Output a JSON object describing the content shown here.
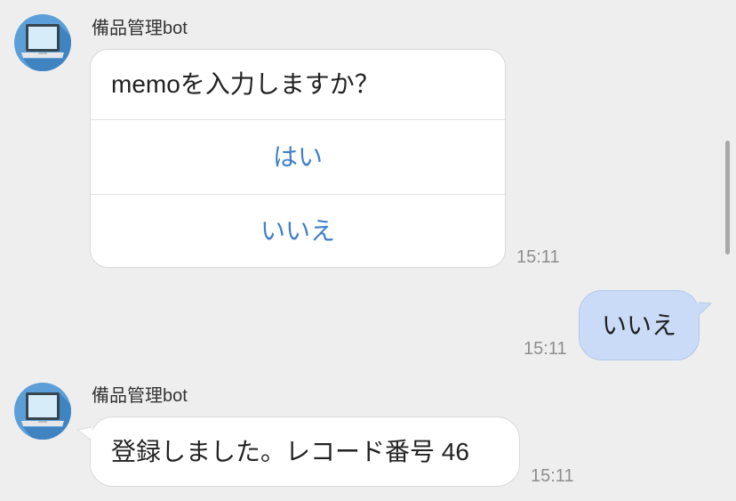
{
  "colors": {
    "background": "#eeeeee",
    "bubble_bot": "#ffffff",
    "bubble_user": "#c9dbf6",
    "button_text": "#3f7fca",
    "timestamp": "#8e8e8e"
  },
  "prompt_message": {
    "sender": "備品管理bot",
    "avatar_icon": "laptop-icon",
    "question": "memoを入力しますか？",
    "options": [
      "はい",
      "いいえ"
    ],
    "time": "15:11"
  },
  "reply_message": {
    "text": "いいえ",
    "time": "15:11"
  },
  "result_message": {
    "sender": "備品管理bot",
    "avatar_icon": "laptop-icon",
    "text": "登録しました。レコード番号 46",
    "time": "15:11"
  }
}
